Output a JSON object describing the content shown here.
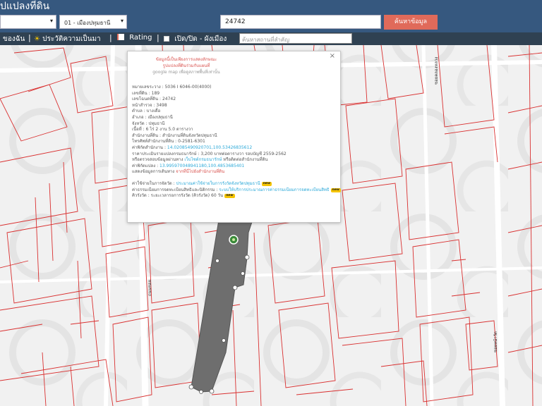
{
  "header": {
    "title": "ปแปลงที่ดิน",
    "province_select": "",
    "district_select": "01 - เมืองปทุมธานี",
    "parcel_input": "24742",
    "search_button": "ค้นหาข้อมูล"
  },
  "toolbar": {
    "item1": "ของฉัน",
    "item2": "ประวัติความเป็นมา",
    "item3": "Rating",
    "item4": "เปิด/ปิด - ผังเมือง",
    "place_placeholder": "ค้นหาสถานที่สำคัญ",
    "icons": [
      "sun-icon",
      "chart-icon",
      "checkbox-icon"
    ]
  },
  "popup": {
    "close": "×",
    "notice": [
      "ข้อมูลนี้เป็นเพียงการแสดงลักษณะ",
      "รูปแปลงที่ดินร่วมกับแผนที่",
      "google map เพื่อดูสภาพพื้นที่เท่านั้น"
    ],
    "rows": [
      {
        "label": "หมายเลขระวาง",
        "value": "5036 I 6046-00(4000)"
      },
      {
        "label": "เลขที่ดิน",
        "value": "189"
      },
      {
        "label": "เลขโฉนดที่ดิน",
        "value": "24742"
      },
      {
        "label": "หน้าสำรวจ",
        "value": "3498"
      },
      {
        "label": "ตำบล",
        "value": "บางเดื่อ"
      },
      {
        "label": "อำเภอ",
        "value": "เมืองปทุมธานี"
      },
      {
        "label": "จังหวัด",
        "value": "ปทุมธานี"
      },
      {
        "label": "เนื้อที่",
        "value": "6 ไร่ 2 งาน 5.0 ตารางวา"
      },
      {
        "label": "สำนักงานที่ดิน",
        "value": "สำนักงานที่ดินจังหวัดปทุมธานี"
      },
      {
        "label": "โทรศัพท์สำนักงานที่ดิน",
        "value": "0-2581-6301"
      }
    ],
    "office_coord_label": "ค่าพิกัดสำนักงาน",
    "office_coord": "14.02085490920701,100.53426835612",
    "price_line": "ราคาประเมินรายแปลงกรมธนารักษ์ : 3,200 บาทต่อตารางวา รอบบัญชี 2559-2562",
    "check_prefix": "หรือตรวจสอบข้อมูลผ่านทาง",
    "check_link": "เว็บไซต์กรมธนารักษ์",
    "check_suffix": "หรือติดต่อสำนักงานที่ดิน",
    "parcel_coord_label": "ค่าพิกัดแปลง",
    "parcel_coord": "13.995970048941180,100.4853685401",
    "route_prefix": "แสดงข้อมูลการเดินทาง",
    "route_link": "จากที่นี่ไปยังสำนักงานที่ดิน",
    "tx_label": "ค่าใช้จ่ายในการจัดวัด",
    "tx_link": "ประมาณค่าใช้จ่ายในการรังวัดจังหวัดปทุมธานี",
    "fee_label": "ค่าธรรมเนียมการจดทะเบียนสิทธิและนิติกรรม",
    "fee_link": "ระบบให้บริการประมาณการค่าธรรมเนียมการจดทะเบียนสิทธิ",
    "survey_line": "คิวรังวัด : ระยะเวลารอการรังวัด (คิวรังวัด) 60 วัน",
    "new_badge": "new"
  },
  "map": {
    "road_labels": [
      "ถนนซอย",
      "ซอยหน้าวัด",
      "ซอยคลองหลวง"
    ],
    "parcel_color": "#6e6e6e",
    "boundary_color": "#d93030",
    "marker": "map-pin-icon"
  }
}
